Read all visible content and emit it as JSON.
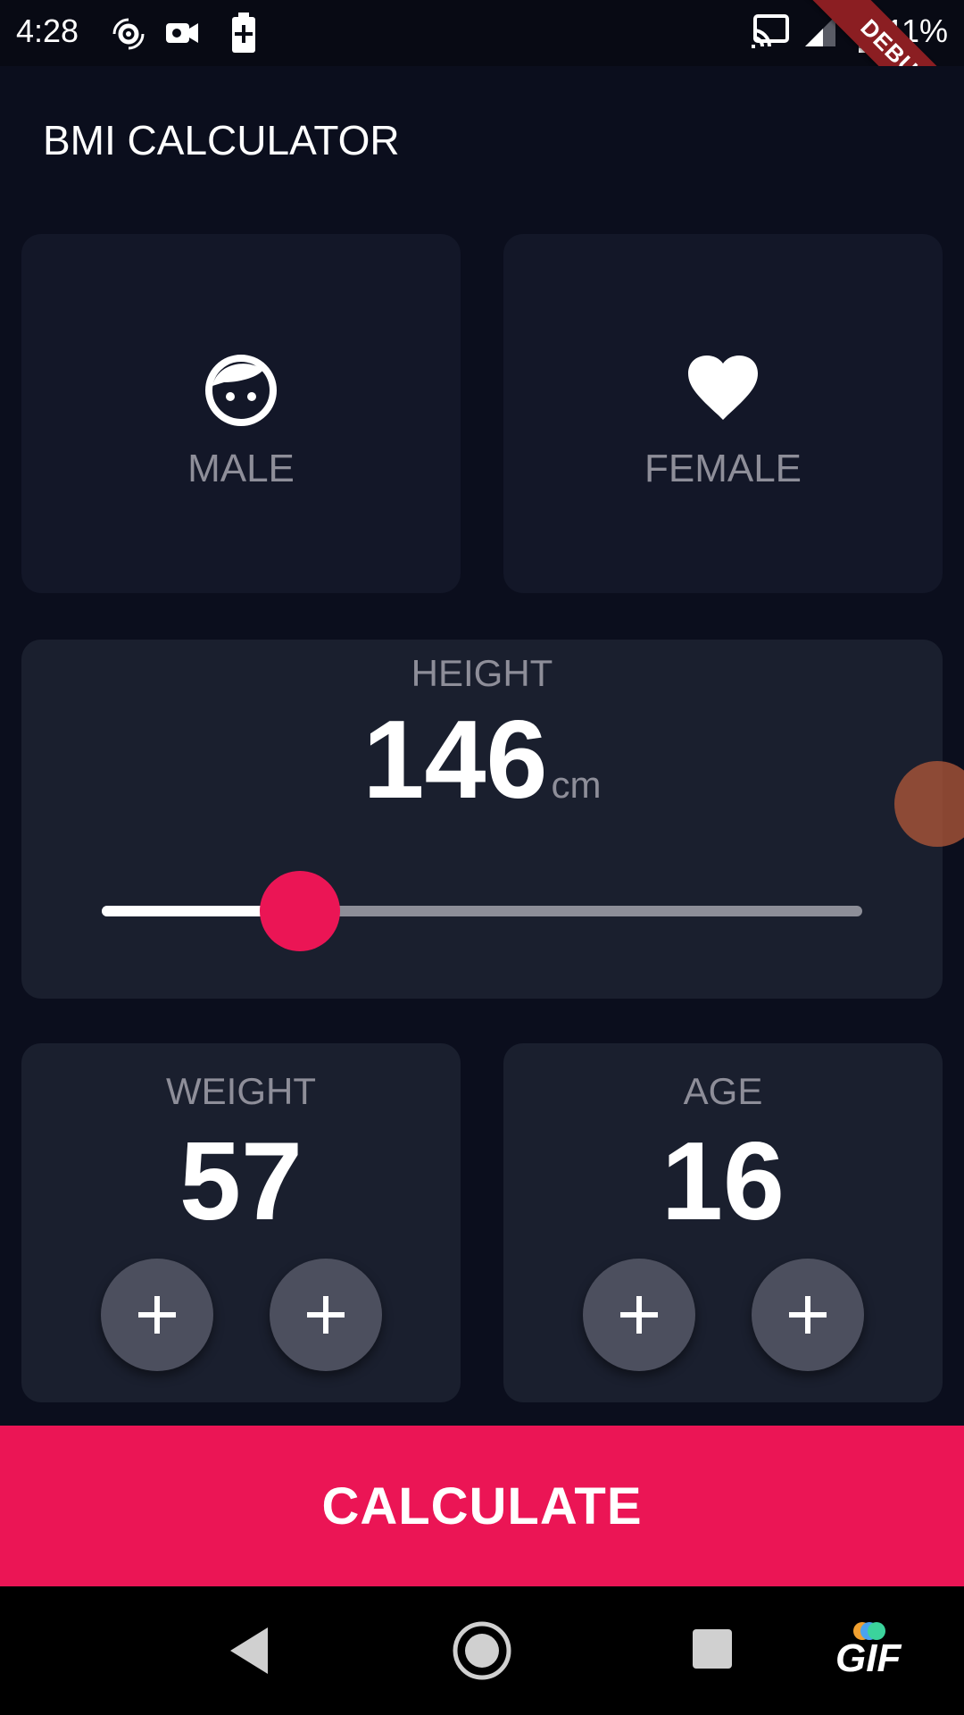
{
  "status_bar": {
    "time": "4:28",
    "battery": "11%",
    "debug_banner": "DEBUG",
    "icons": [
      "settings-sync-icon",
      "camera-icon",
      "battery-saver-icon",
      "cast-icon",
      "signal-icon",
      "battery-icon"
    ]
  },
  "app_bar": {
    "title": "BMI CALCULATOR"
  },
  "gender": {
    "male": {
      "label": "MALE",
      "icon": "face-icon"
    },
    "female": {
      "label": "FEMALE",
      "icon": "heart-icon"
    }
  },
  "height": {
    "label": "HEIGHT",
    "value": "146",
    "unit": "cm",
    "slider_fraction": 0.26
  },
  "weight": {
    "label": "WEIGHT",
    "value": "57",
    "buttons": [
      "+",
      "+"
    ]
  },
  "age": {
    "label": "AGE",
    "value": "16",
    "buttons": [
      "+",
      "+"
    ]
  },
  "calculate": {
    "label": "CALCULATE"
  },
  "nav_bar": {
    "gif_badge": "GIF",
    "icons": [
      "back-icon",
      "home-icon",
      "recents-icon"
    ]
  },
  "colors": {
    "background": "#0b0e1d",
    "card": "#131728",
    "accent": "#eb1555",
    "muted_text": "#8e8e99"
  }
}
